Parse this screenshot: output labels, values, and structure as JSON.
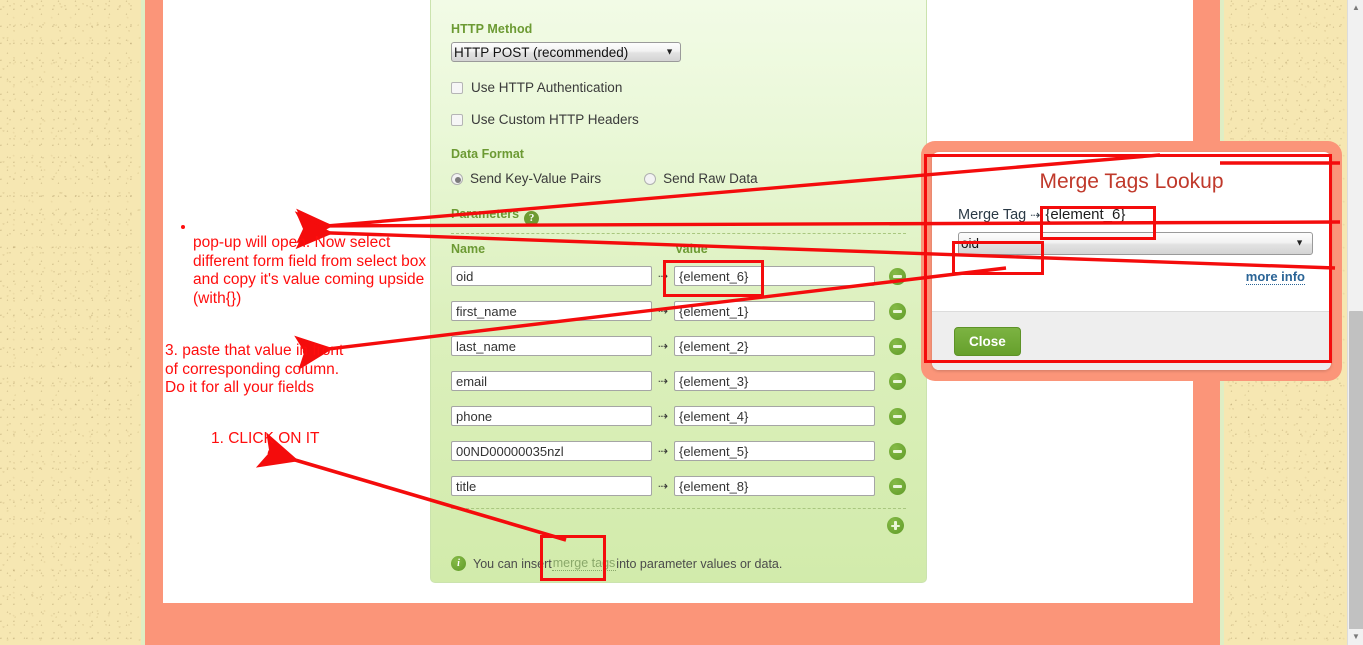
{
  "form": {
    "http_method_label": "HTTP Method",
    "http_method_value": "HTTP POST (recommended)",
    "checkbox_http_auth": "Use HTTP Authentication",
    "checkbox_custom_headers": "Use Custom HTTP Headers",
    "data_format_label": "Data Format",
    "radio_key_value": "Send Key-Value Pairs",
    "radio_raw_data": "Send Raw Data",
    "parameters_label": "Parameters",
    "help_badge": "?",
    "col_name": "Name",
    "col_value": "Value",
    "arrow_glyph": "⇢",
    "rows": [
      {
        "name": "oid",
        "value": "{element_6}"
      },
      {
        "name": "first_name",
        "value": "{element_1}"
      },
      {
        "name": "last_name",
        "value": "{element_2}"
      },
      {
        "name": "email",
        "value": "{element_3}"
      },
      {
        "name": "phone",
        "value": "{element_4}"
      },
      {
        "name": "00ND00000035nzl",
        "value": "{element_5}"
      },
      {
        "name": "title",
        "value": "{element_8}"
      }
    ],
    "info_text_before": "You can insert ",
    "info_link": "merge tags",
    "info_text_after": " into parameter values or data."
  },
  "merge_tags_dialog": {
    "title": "Merge Tags Lookup",
    "merge_tag_label": "Merge Tag",
    "merge_tag_arrow": "⇢",
    "merge_tag_value": "{element_6}",
    "select_value": "oid",
    "select_caret": "▼",
    "more_info": "more info",
    "close_label": "Close"
  },
  "annotations": {
    "note_popup": "pop-up will open. Now select\ndifferent form field from select box\nand copy it's value coming upside\n(with{})",
    "note_paste": "3. paste that value in front\nof corresponding column.\nDo it for all your fields",
    "note_click": "1. CLICK ON IT"
  },
  "scrollbar": {
    "up_glyph": "▲",
    "down_glyph": "▼"
  },
  "colors": {
    "annotation_red": "#ff0d0d",
    "highlight_red": "#f40c0c",
    "panel_green": "#d2ebab",
    "label_green": "#6c9a33",
    "dialog_title_red": "#c0392b",
    "frame_coral": "#fb9579",
    "close_button_green": "#7cb342",
    "link_blue": "#2a6496"
  }
}
